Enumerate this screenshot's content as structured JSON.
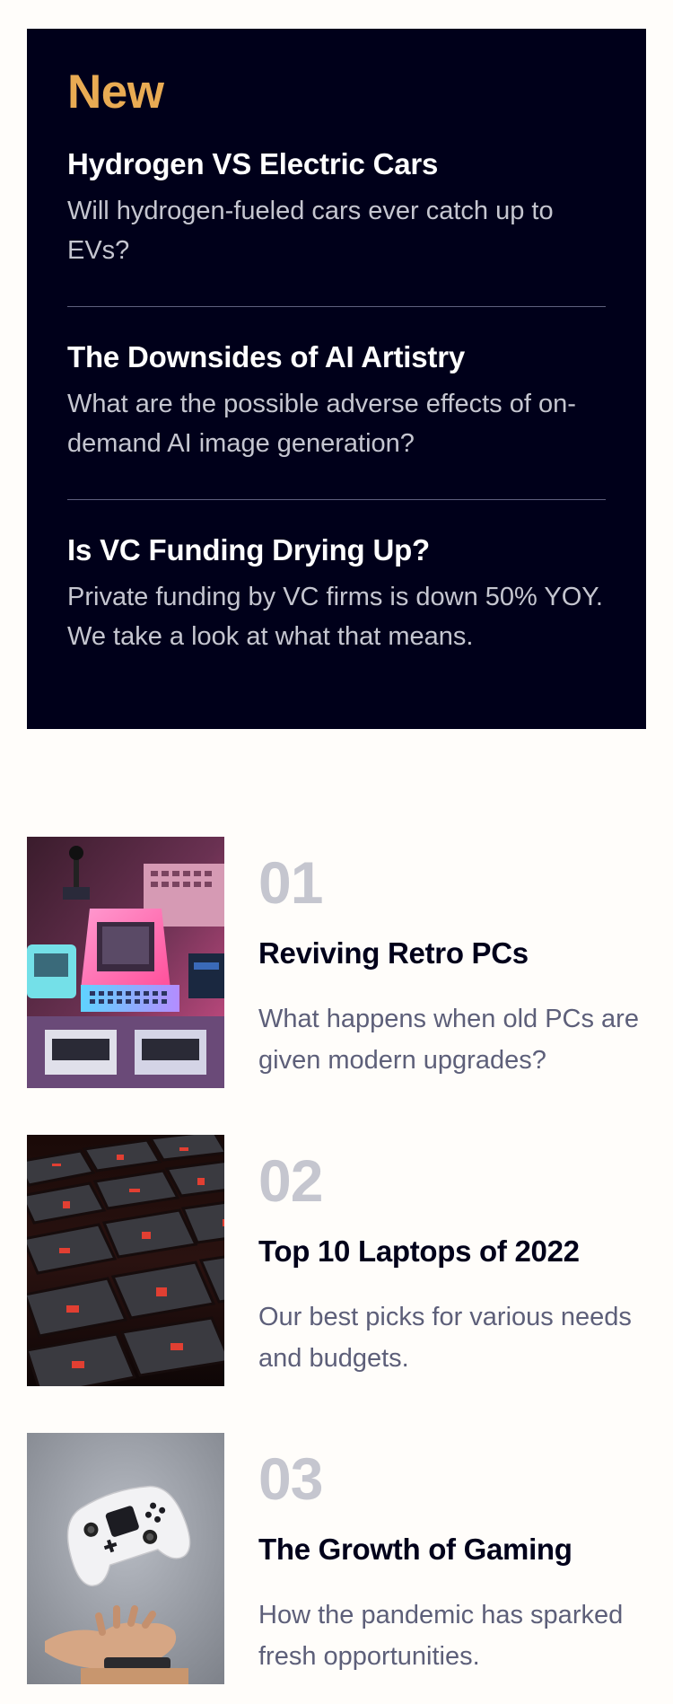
{
  "new_section": {
    "heading": "New",
    "items": [
      {
        "title": "Hydrogen VS Electric Cars",
        "description": "Will hydrogen-fueled cars ever catch up to EVs?"
      },
      {
        "title": "The Downsides of AI Artistry",
        "description": "What are the possible adverse effects of on-demand AI image generation?"
      },
      {
        "title": "Is VC Funding Drying Up?",
        "description": "Private funding by VC firms is down 50% YOY. We take a look at what that means."
      }
    ]
  },
  "articles": [
    {
      "number": "01",
      "title": "Reviving Retro PCs",
      "description": "What happens when old PCs are given modern upgrades?",
      "image": "retro-pc-image"
    },
    {
      "number": "02",
      "title": "Top 10 Laptops of 2022",
      "description": "Our best picks for various needs and budgets.",
      "image": "laptop-keyboard-image"
    },
    {
      "number": "03",
      "title": "The Growth of Gaming",
      "description": "How the pandemic has sparked fresh opportunities.",
      "image": "game-controller-image"
    }
  ],
  "colors": {
    "background": "#fffdfa",
    "dark_panel": "#00001a",
    "accent": "#e9ab53",
    "muted_number": "#c5c6cf",
    "body_text": "#5d5f79"
  }
}
